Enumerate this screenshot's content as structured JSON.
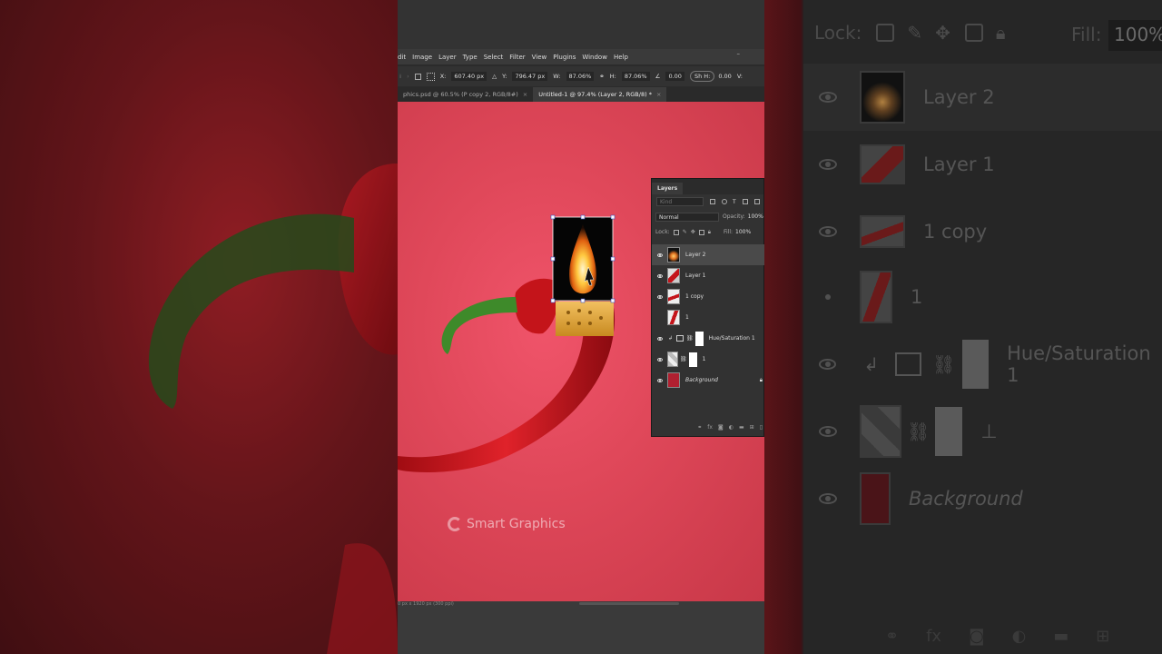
{
  "menu": [
    "dit",
    "Image",
    "Layer",
    "Type",
    "Select",
    "Filter",
    "View",
    "Plugins",
    "Window",
    "Help"
  ],
  "window_min": "–",
  "options": {
    "x_label": "X:",
    "x_value": "607.40 px",
    "y_label": "Y:",
    "y_value": "796.47 px",
    "w_label": "W:",
    "w_value": "87.06%",
    "h_label": "H:",
    "h_value": "87.06%",
    "angle_value": "0.00",
    "sh_label": "Sh H:",
    "sh_value": "0.00",
    "v_label": "V:"
  },
  "tabs": [
    {
      "label": "phics.psd @ 60.5% (P copy 2, RGB/8#)",
      "active": false
    },
    {
      "label": "Untitled-1 @ 97.4% (Layer 2, RGB/8) *",
      "active": true
    }
  ],
  "tab_close": "×",
  "watermark": "Smart Graphics",
  "status_text": "0 px x 1920 px (300 ppi)",
  "layers_panel": {
    "title": "Layers",
    "search_placeholder": "Kind",
    "blend_mode": "Normal",
    "opacity_label": "Opacity:",
    "opacity_value": "100%",
    "lock_label": "Lock:",
    "fill_label": "Fill:",
    "fill_value": "100%",
    "layers": [
      {
        "name": "Layer 2",
        "visible": true,
        "selected": true,
        "thumb": "flame"
      },
      {
        "name": "Layer 1",
        "visible": true,
        "selected": false,
        "thumb": "pepper"
      },
      {
        "name": "1 copy",
        "visible": true,
        "selected": false,
        "thumb": "pepper-red"
      },
      {
        "name": "1",
        "visible": false,
        "selected": false,
        "thumb": "pepper-red"
      },
      {
        "name": "Hue/Saturation 1",
        "visible": true,
        "selected": false,
        "thumb": "adjustment"
      },
      {
        "name": "1",
        "visible": true,
        "selected": false,
        "thumb": "smart"
      },
      {
        "name": "Background",
        "visible": true,
        "selected": false,
        "thumb": "red-bg",
        "locked": true
      }
    ],
    "footer_icons": [
      "link-icon",
      "fx-icon",
      "mask-icon",
      "adjustment-icon",
      "folder-icon",
      "new-layer-icon"
    ],
    "footer_fx": "fx"
  },
  "right_panel": {
    "lock_label": "Lock:",
    "fill_label": "Fill:",
    "fill_value": "100%",
    "layers": [
      "Layer 2",
      "Layer 1",
      "1 copy",
      "1",
      "Hue/Saturation 1",
      "⊥",
      "Background"
    ],
    "footer_fx": "fx"
  },
  "colors": {
    "canvas_bg": "#e0485a",
    "pepper_red": "#c4141a",
    "stem_green": "#3e8a2a",
    "lighter_gold": "#e0a030"
  }
}
